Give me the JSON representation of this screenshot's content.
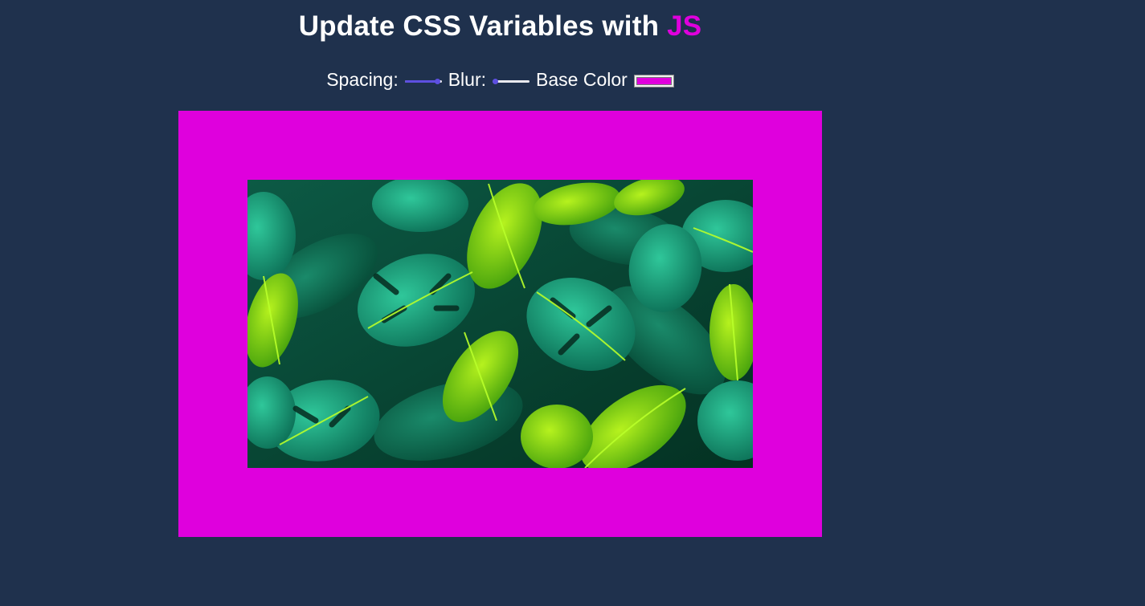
{
  "heading": {
    "prefix": "Update CSS Variables with ",
    "highlight": "JS"
  },
  "controls": {
    "spacing_label": "Spacing:",
    "spacing_value": 0.9,
    "blur_label": "Blur:",
    "blur_value": 0.08,
    "base_color_label": "Base Color",
    "base_color_value": "#df00dd"
  },
  "colors": {
    "background": "#1f314d",
    "accent": "#df00dd",
    "slider_fill": "#5d4fe0"
  },
  "image": {
    "subject": "tropical monstera and palm leaves"
  }
}
